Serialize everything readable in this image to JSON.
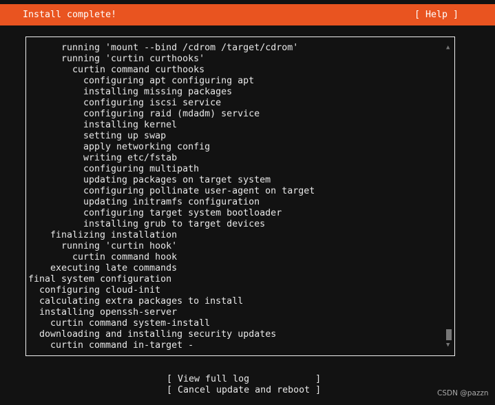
{
  "header": {
    "title": "Install complete!",
    "help_label": "[ Help ]",
    "color": "#e95420"
  },
  "log": {
    "lines": [
      {
        "indent": 6,
        "text": "running 'mount --bind /cdrom /target/cdrom'"
      },
      {
        "indent": 6,
        "text": "running 'curtin curthooks'"
      },
      {
        "indent": 8,
        "text": "curtin command curthooks"
      },
      {
        "indent": 10,
        "text": "configuring apt configuring apt"
      },
      {
        "indent": 10,
        "text": "installing missing packages"
      },
      {
        "indent": 10,
        "text": "configuring iscsi service"
      },
      {
        "indent": 10,
        "text": "configuring raid (mdadm) service"
      },
      {
        "indent": 10,
        "text": "installing kernel"
      },
      {
        "indent": 10,
        "text": "setting up swap"
      },
      {
        "indent": 10,
        "text": "apply networking config"
      },
      {
        "indent": 10,
        "text": "writing etc/fstab"
      },
      {
        "indent": 10,
        "text": "configuring multipath"
      },
      {
        "indent": 10,
        "text": "updating packages on target system"
      },
      {
        "indent": 10,
        "text": "configuring pollinate user-agent on target"
      },
      {
        "indent": 10,
        "text": "updating initramfs configuration"
      },
      {
        "indent": 10,
        "text": "configuring target system bootloader"
      },
      {
        "indent": 10,
        "text": "installing grub to target devices"
      },
      {
        "indent": 4,
        "text": "finalizing installation"
      },
      {
        "indent": 6,
        "text": "running 'curtin hook'"
      },
      {
        "indent": 8,
        "text": "curtin command hook"
      },
      {
        "indent": 4,
        "text": "executing late commands"
      },
      {
        "indent": 0,
        "text": "final system configuration"
      },
      {
        "indent": 2,
        "text": "configuring cloud-init"
      },
      {
        "indent": 2,
        "text": "calculating extra packages to install"
      },
      {
        "indent": 2,
        "text": "installing openssh-server"
      },
      {
        "indent": 4,
        "text": "curtin command system-install"
      },
      {
        "indent": 2,
        "text": "downloading and installing security updates"
      },
      {
        "indent": 4,
        "text": "curtin command in-target -"
      }
    ],
    "scroll_position": 1.0
  },
  "buttons": {
    "view_log": "[ View full log            ]",
    "cancel_reboot": "[ Cancel update and reboot ]"
  },
  "watermark": "CSDN @pazzn"
}
